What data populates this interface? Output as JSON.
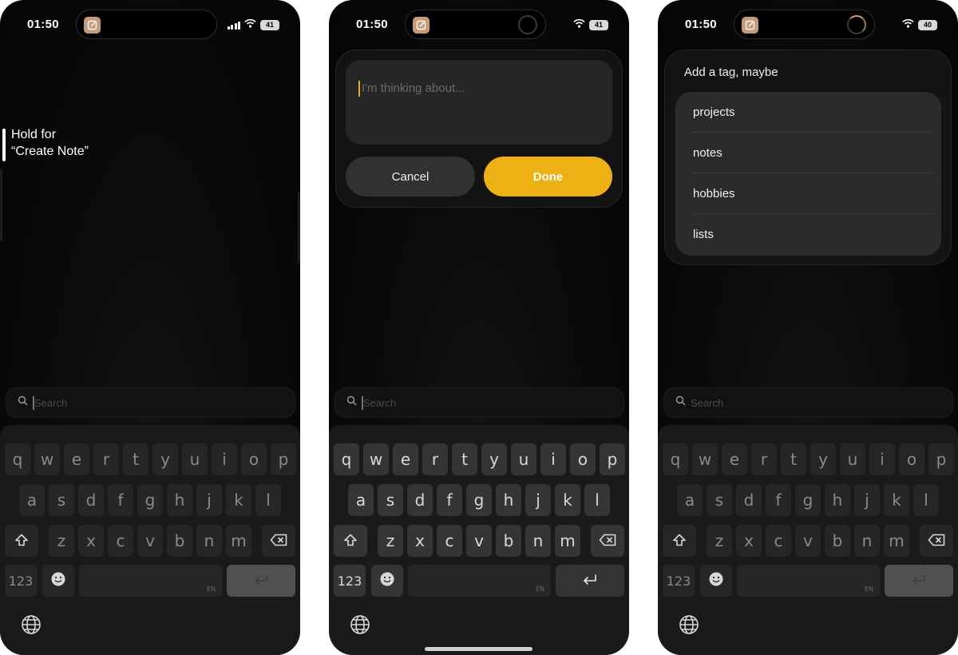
{
  "screens": [
    {
      "status": {
        "time": "01:50",
        "battery": "41"
      },
      "hint": {
        "line1": "Hold for",
        "line2": "“Create Note”"
      },
      "search": {
        "placeholder": "Search"
      },
      "keyboard": {
        "space_label": "EN"
      }
    },
    {
      "status": {
        "time": "01:50",
        "battery": "41"
      },
      "note": {
        "placeholder": "I'm thinking about..."
      },
      "buttons": {
        "cancel": "Cancel",
        "done": "Done"
      },
      "search": {
        "placeholder": "Search"
      },
      "keyboard": {
        "space_label": "EN"
      }
    },
    {
      "status": {
        "time": "01:50",
        "battery": "40"
      },
      "tags": {
        "title": "Add a tag, maybe",
        "items": [
          "projects",
          "notes",
          "hobbies",
          "lists"
        ]
      },
      "search": {
        "placeholder": "Search"
      },
      "keyboard": {
        "space_label": "EN"
      }
    }
  ],
  "keyboard_layout": {
    "row1": [
      "q",
      "w",
      "e",
      "r",
      "t",
      "y",
      "u",
      "i",
      "o",
      "p"
    ],
    "row2": [
      "a",
      "s",
      "d",
      "f",
      "g",
      "h",
      "j",
      "k",
      "l"
    ],
    "row3": [
      "z",
      "x",
      "c",
      "v",
      "b",
      "n",
      "m"
    ],
    "numbers_key": "123"
  },
  "colors": {
    "accent": "#eeb114",
    "background": "#0a0a0a",
    "key": "#353535"
  },
  "icons": [
    "compose-icon",
    "wifi-icon",
    "signal-icon",
    "search-icon",
    "shift-icon",
    "delete-icon",
    "emoji-icon",
    "globe-icon",
    "return-icon"
  ]
}
